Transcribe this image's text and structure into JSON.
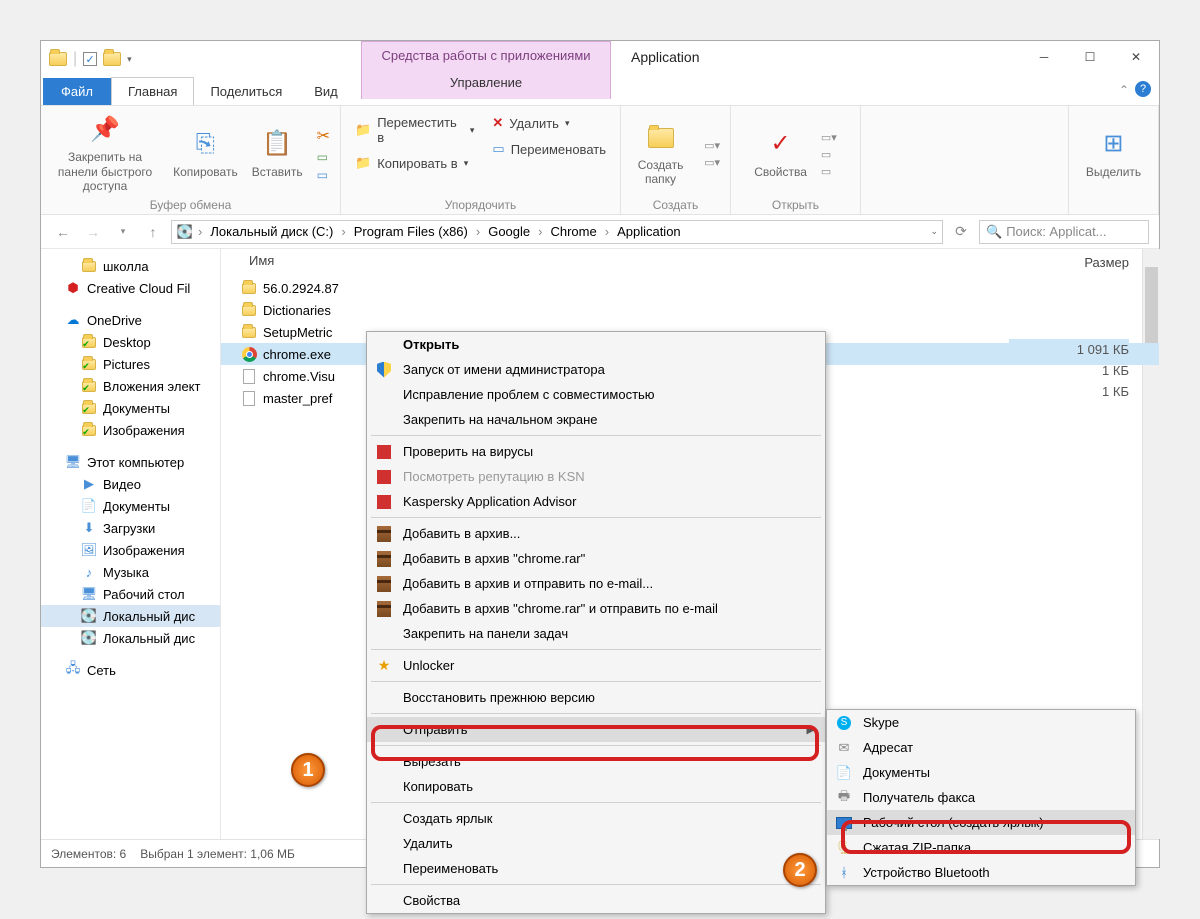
{
  "title": {
    "contextual_label": "Средства работы с приложениями",
    "contextual_sub": "Управление",
    "app_title": "Application"
  },
  "tabs": {
    "file": "Файл",
    "home": "Главная",
    "share": "Поделиться",
    "view": "Вид"
  },
  "ribbon": {
    "clipboard": {
      "pin": "Закрепить на панели быстрого доступа",
      "copy": "Копировать",
      "paste": "Вставить",
      "group": "Буфер обмена"
    },
    "organize": {
      "move_to": "Переместить в",
      "copy_to": "Копировать в",
      "delete": "Удалить",
      "rename": "Переименовать",
      "group": "Упорядочить"
    },
    "new": {
      "new_folder": "Создать папку",
      "group": "Создать"
    },
    "open": {
      "properties": "Свойства",
      "group": "Открыть"
    },
    "select": {
      "select": "Выделить"
    }
  },
  "breadcrumb": [
    "Локальный диск (C:)",
    "Program Files (x86)",
    "Google",
    "Chrome",
    "Application"
  ],
  "search_placeholder": "Поиск: Applicat...",
  "columns": {
    "name": "Имя",
    "size": "Размер"
  },
  "nav": {
    "items": [
      {
        "label": "школла",
        "icon": "folder",
        "lvl": 1
      },
      {
        "label": "Creative Cloud Fil",
        "icon": "cc",
        "lvl": 0
      },
      {
        "label": "OneDrive",
        "icon": "cloud",
        "lvl": 0
      },
      {
        "label": "Desktop",
        "icon": "folder-check",
        "lvl": 1
      },
      {
        "label": "Pictures",
        "icon": "folder-check",
        "lvl": 1
      },
      {
        "label": "Вложения элект",
        "icon": "folder-check",
        "lvl": 1
      },
      {
        "label": "Документы",
        "icon": "folder-check",
        "lvl": 1
      },
      {
        "label": "Изображения",
        "icon": "folder-check",
        "lvl": 1
      },
      {
        "label": "Этот компьютер",
        "icon": "pc",
        "lvl": 0
      },
      {
        "label": "Видео",
        "icon": "video",
        "lvl": 1
      },
      {
        "label": "Документы",
        "icon": "docs",
        "lvl": 1
      },
      {
        "label": "Загрузки",
        "icon": "dl",
        "lvl": 1
      },
      {
        "label": "Изображения",
        "icon": "img",
        "lvl": 1
      },
      {
        "label": "Музыка",
        "icon": "music",
        "lvl": 1
      },
      {
        "label": "Рабочий стол",
        "icon": "desktop",
        "lvl": 1
      },
      {
        "label": "Локальный дис",
        "icon": "disk",
        "lvl": 1,
        "sel": true
      },
      {
        "label": "Локальный дис",
        "icon": "disk",
        "lvl": 1
      },
      {
        "label": "Сеть",
        "icon": "net",
        "lvl": 0
      }
    ]
  },
  "files": [
    {
      "name": "56.0.2924.87",
      "icon": "folder",
      "size": ""
    },
    {
      "name": "Dictionaries",
      "icon": "folder",
      "size": ""
    },
    {
      "name": "SetupMetric",
      "icon": "folder",
      "size": ""
    },
    {
      "name": "chrome.exe",
      "icon": "chrome",
      "size": "1 091 КБ",
      "sel": true
    },
    {
      "name": "chrome.Visu",
      "icon": "doc",
      "size": "1 КБ"
    },
    {
      "name": "master_pref",
      "icon": "doc",
      "size": "1 КБ"
    }
  ],
  "status": {
    "count": "Элементов: 6",
    "selection": "Выбран 1 элемент: 1,06 МБ"
  },
  "ctx1": [
    {
      "label": "Открыть",
      "bold": true
    },
    {
      "label": "Запуск от имени администратора",
      "icon": "shield"
    },
    {
      "label": "Исправление проблем с совместимостью"
    },
    {
      "label": "Закрепить на начальном экране"
    },
    {
      "sep": true
    },
    {
      "label": "Проверить на вирусы",
      "icon": "kasp"
    },
    {
      "label": "Посмотреть репутацию в KSN",
      "icon": "kasp",
      "dim": true
    },
    {
      "label": "Kaspersky Application Advisor",
      "icon": "kasp"
    },
    {
      "sep": true
    },
    {
      "label": "Добавить в архив...",
      "icon": "rar"
    },
    {
      "label": "Добавить в архив \"chrome.rar\"",
      "icon": "rar"
    },
    {
      "label": "Добавить в архив и отправить по e-mail...",
      "icon": "rar"
    },
    {
      "label": "Добавить в архив \"chrome.rar\" и отправить по e-mail",
      "icon": "rar"
    },
    {
      "label": "Закрепить на панели задач"
    },
    {
      "sep": true
    },
    {
      "label": "Unlocker",
      "icon": "star"
    },
    {
      "sep": true
    },
    {
      "label": "Восстановить прежнюю версию"
    },
    {
      "sep": true
    },
    {
      "label": "Отправить",
      "arrow": true,
      "hl": true
    },
    {
      "sep": true
    },
    {
      "label": "Вырезать"
    },
    {
      "label": "Копировать"
    },
    {
      "sep": true
    },
    {
      "label": "Создать ярлык"
    },
    {
      "label": "Удалить"
    },
    {
      "label": "Переименовать"
    },
    {
      "sep": true
    },
    {
      "label": "Свойства"
    }
  ],
  "ctx2": [
    {
      "label": "Skype",
      "icon": "skype"
    },
    {
      "label": "Адресат",
      "icon": "mail"
    },
    {
      "label": "Документы",
      "icon": "docs"
    },
    {
      "label": "Получатель факса",
      "icon": "fax"
    },
    {
      "label": "Рабочий стол (создать ярлык)",
      "icon": "monitor",
      "hl": true
    },
    {
      "label": "Сжатая ZIP-папка",
      "icon": "zip"
    },
    {
      "label": "Устройство Bluetooth",
      "icon": "bt"
    }
  ],
  "badges": {
    "one": "1",
    "two": "2"
  }
}
